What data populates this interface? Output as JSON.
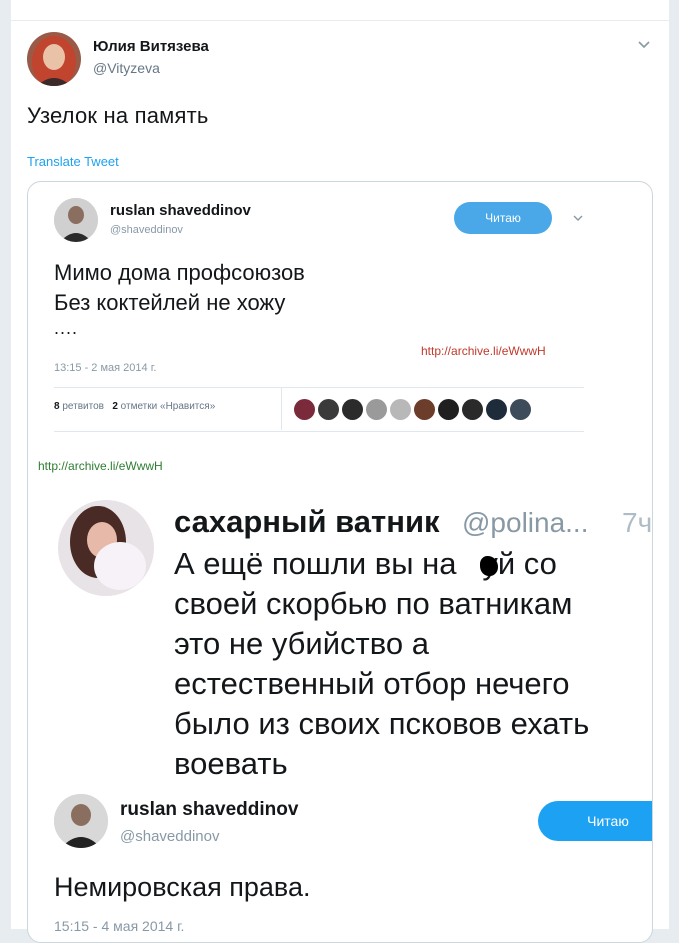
{
  "tweet": {
    "author_name": "Юлия Витязева",
    "author_handle": "@Vityzeva",
    "text": "Узелок на память",
    "translate_label": "Translate Tweet"
  },
  "embedded": {
    "name": "ruslan shaveddinov",
    "handle": "@shaveddinov",
    "follow_label": "Читаю",
    "line1": "Мимо дома профсоюзов",
    "line2": "Без коктейлей не хожу",
    "dots": "....",
    "url_stamp": "http://archive.li/eWwwH",
    "date": "13:15 - 2 мая 2014 г.",
    "retweets_count": "8",
    "retweets_label": "ретвитов",
    "likes_count": "2",
    "likes_label": "отметки «Нравится»",
    "liker_colors": [
      "#7a2a3a",
      "#3a3a3a",
      "#2b2b2b",
      "#9a9a9a",
      "#b8b8b8",
      "#6b3d2a",
      "#1f1f1f",
      "#2a2a2a",
      "#1d2b3a",
      "#3d4b5a"
    ]
  },
  "archive_link": "http://archive.li/eWwwH",
  "quoted": {
    "name": "сахарный ватник",
    "handle": "@polina...",
    "time": "7ч",
    "text": "А ещё пошли вы на   уй со\nсвоей скорбью по ватникам\nэто не убийство а\nестественный отбор нечего\nбыло из своих псковов ехать\nвоевать"
  },
  "reply": {
    "name": "ruslan shaveddinov",
    "handle": "@shaveddinov",
    "follow_label": "Читаю",
    "text": "Немировская права.",
    "date": "15:15 - 4 мая 2014 г."
  },
  "colors": {
    "accent": "#1da1f2",
    "muted": "#657786",
    "url_red": "#c0392b",
    "link_green": "#2e7d32"
  }
}
